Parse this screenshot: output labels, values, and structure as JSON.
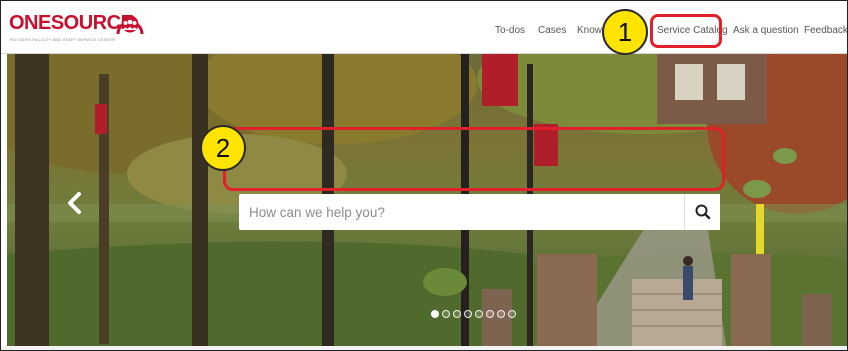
{
  "logo": {
    "name": "ONESOURCE",
    "tagline": "RUTGERS FACULTY AND STAFF SERVICE CENTER"
  },
  "nav": {
    "items": [
      {
        "label": "To-dos"
      },
      {
        "label": "Cases"
      },
      {
        "label": "Know"
      },
      {
        "label": "Service Catalog"
      },
      {
        "label": "Ask a question"
      },
      {
        "label": "Feedback"
      }
    ]
  },
  "search": {
    "placeholder": "How can we help you?"
  },
  "carousel": {
    "slide_count": 8,
    "active_index": 0
  },
  "callouts": {
    "one": "1",
    "two": "2"
  },
  "colors": {
    "brand": "#c8102e",
    "highlight": "#e0202a",
    "callout": "#ffe400"
  },
  "icons": {
    "search": "magnifier-icon",
    "prev": "chevron-left-icon",
    "emblem": "people-emblem-icon"
  }
}
